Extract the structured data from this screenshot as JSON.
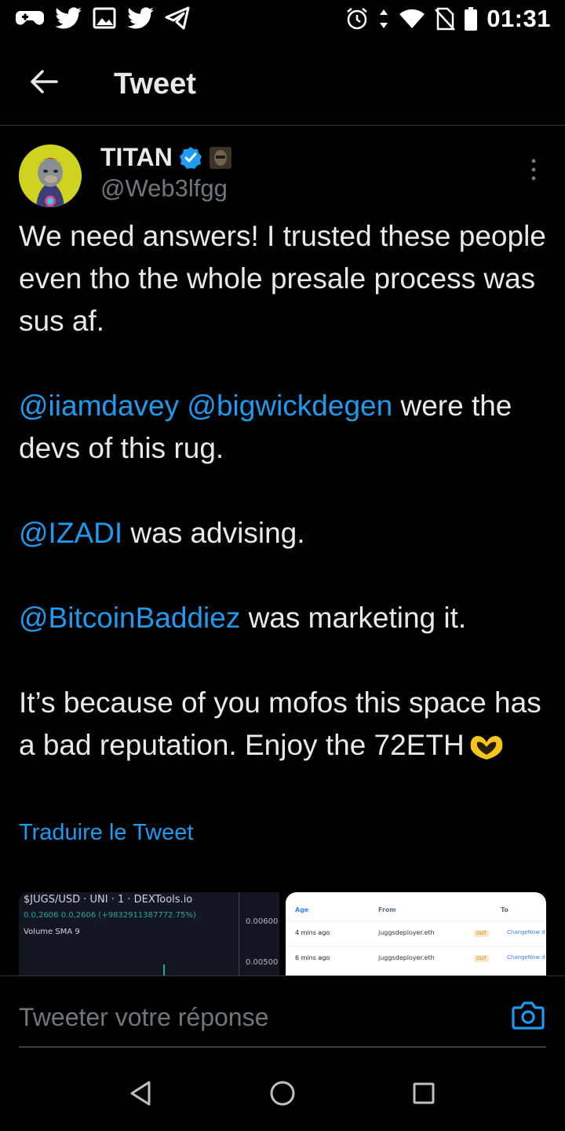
{
  "status_bar": {
    "time": "01:31",
    "left_icons": [
      "gamepad-icon",
      "twitter-icon",
      "gallery-icon",
      "twitter-icon",
      "telegram-icon"
    ],
    "right_icons": [
      "alarm-icon",
      "data-arrows-icon",
      "wifi-icon",
      "no-sim-icon",
      "battery-icon"
    ]
  },
  "header": {
    "title": "Tweet",
    "back_icon": "arrow-left-icon"
  },
  "tweet": {
    "author_name": "TITAN",
    "author_handle": "@Web3lfgg",
    "paragraphs": {
      "p1": "We need answers! I trusted these people even tho the whole presale process was sus af.",
      "p2_mention1": "@iiamdavey",
      "p2_mention2": "@bigwickdegen",
      "p2_text": " were the devs of this rug.",
      "p3_mention": "@IZADI",
      "p3_text": " was advising.",
      "p4_mention": "@BitcoinBaddiez",
      "p4_text": " was marketing it.",
      "p5_text": "It’s because of you mofos this space has a bad reputation. Enjoy the 72ETH"
    },
    "translate_label": "Traduire le Tweet"
  },
  "media": {
    "chart": {
      "title": "$JUGS/USD · UNI · 1 · DEXTools.io",
      "values": "0.0,2606  0.0,2606 (+9832911387772.75%)",
      "volume_label": "Volume SMA 9",
      "axis_top": "0.00600",
      "axis_bottom": "0.00500"
    },
    "table": {
      "headers": {
        "age": "Age",
        "from": "From",
        "to": "To"
      },
      "rows": [
        {
          "age": "4 mins ago",
          "from": "juggsdeployer.eth",
          "type": "OUT",
          "to": "ChangeNow d"
        },
        {
          "age": "6 mins ago",
          "from": "juggsdeployer.eth",
          "type": "OUT",
          "to": "ChangeNow d"
        }
      ]
    }
  },
  "reply": {
    "placeholder": "Tweeter votre réponse",
    "camera_icon": "camera-icon"
  },
  "colors": {
    "background": "#000000",
    "text": "#e7e9ea",
    "secondary": "#71767b",
    "accent": "#1d9bf0",
    "divider": "#2f3336"
  }
}
